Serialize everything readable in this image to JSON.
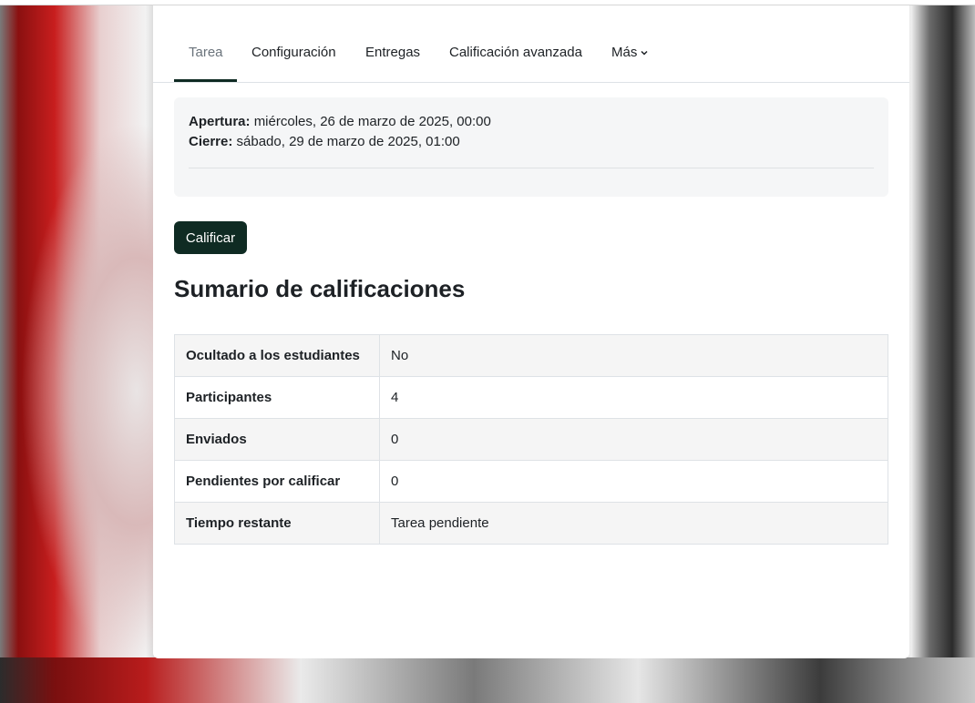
{
  "tabs": [
    {
      "label": "Tarea",
      "active": true
    },
    {
      "label": "Configuración",
      "active": false
    },
    {
      "label": "Entregas",
      "active": false
    },
    {
      "label": "Calificación avanzada",
      "active": false
    },
    {
      "label": "Más",
      "active": false,
      "icon": "chevron-down-icon"
    }
  ],
  "dates": {
    "opening_label": "Apertura:",
    "opening_value": "miércoles, 26 de marzo de 2025, 00:00",
    "closing_label": "Cierre:",
    "closing_value": "sábado, 29 de marzo de 2025, 01:00"
  },
  "grade_button": "Calificar",
  "summary": {
    "title": "Sumario de calificaciones",
    "rows": [
      {
        "label": "Ocultado a los estudiantes",
        "value": "No"
      },
      {
        "label": "Participantes",
        "value": "4"
      },
      {
        "label": "Enviados",
        "value": "0"
      },
      {
        "label": "Pendientes por calificar",
        "value": "0"
      },
      {
        "label": "Tiempo restante",
        "value": "Tarea pendiente"
      }
    ]
  },
  "colors": {
    "primary_button": "#0f2b23",
    "active_tab_underline": "#0f2b23",
    "active_tab_text": "#6a737b"
  }
}
